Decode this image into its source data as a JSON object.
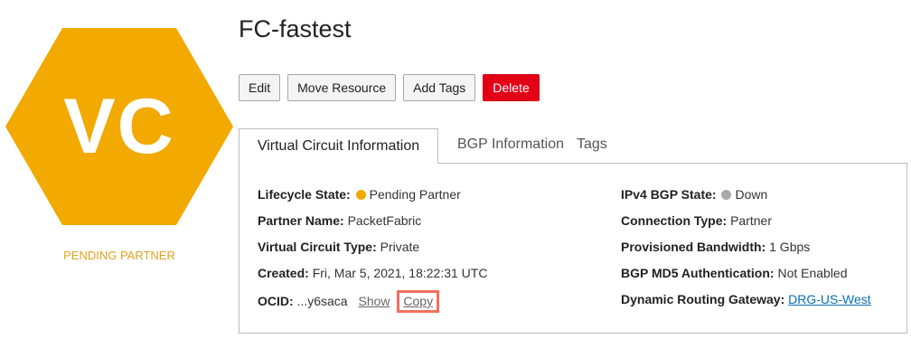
{
  "badge": {
    "text": "VC",
    "status_caption": "PENDING PARTNER",
    "hex_color": "#f2a900"
  },
  "title": "FC-fastest",
  "actions": {
    "edit": "Edit",
    "move_resource": "Move Resource",
    "add_tags": "Add Tags",
    "delete": "Delete"
  },
  "tabs": [
    {
      "label": "Virtual Circuit Information",
      "active": true
    },
    {
      "label": "BGP Information",
      "active": false
    },
    {
      "label": "Tags",
      "active": false
    }
  ],
  "info_left": {
    "lifecycle_state": {
      "label": "Lifecycle State:",
      "value": "Pending Partner",
      "dot_color": "#f2a900"
    },
    "partner_name": {
      "label": "Partner Name:",
      "value": "PacketFabric"
    },
    "circuit_type": {
      "label": "Virtual Circuit Type:",
      "value": "Private"
    },
    "created": {
      "label": "Created:",
      "value": "Fri, Mar 5, 2021, 18:22:31 UTC"
    },
    "ocid": {
      "label": "OCID:",
      "value": "...y6saca",
      "show": "Show",
      "copy": "Copy"
    }
  },
  "info_right": {
    "ipv4_bgp_state": {
      "label": "IPv4 BGP State:",
      "value": "Down",
      "dot_color": "#aaaaaa"
    },
    "connection_type": {
      "label": "Connection Type:",
      "value": "Partner"
    },
    "provisioned_bandwidth": {
      "label": "Provisioned Bandwidth:",
      "value": "1 Gbps"
    },
    "bgp_md5": {
      "label": "BGP MD5 Authentication:",
      "value": "Not Enabled"
    },
    "drg": {
      "label": "Dynamic Routing Gateway:",
      "value": "DRG-US-West"
    }
  }
}
